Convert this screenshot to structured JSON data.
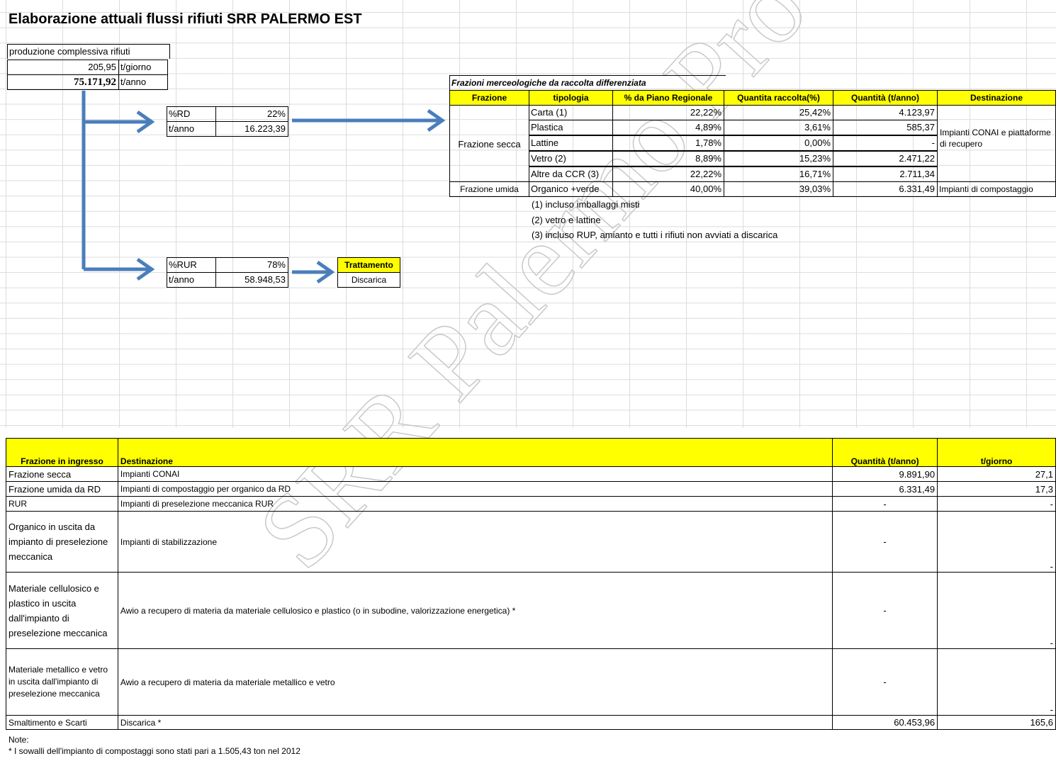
{
  "title": "Elaborazione attuali flussi rifiuti SRR PALERMO EST",
  "production": {
    "label": "produzione complessiva rifiuti",
    "daily_value": "205,95",
    "daily_unit": "t/giorno",
    "yearly_value": "75.171,92",
    "yearly_unit": "t/anno"
  },
  "rd_box": {
    "pct_label": "%RD",
    "pct_value": "22%",
    "t_label": "t/anno",
    "t_value": "16.223,39"
  },
  "rur_box": {
    "pct_label": "%RUR",
    "pct_value": "78%",
    "t_label": "t/anno",
    "t_value": "58.948,53"
  },
  "treatment": {
    "header": "Trattamento",
    "value": "Discarica"
  },
  "fractions_table": {
    "caption": "Frazioni merceologiche da raccolta differenziata",
    "headers": [
      "Frazione",
      "tipologia",
      "% da Piano Regionale",
      "Quantita raccolta(%)",
      "Quantità (t/anno)",
      "Destinazione"
    ],
    "group_secca": "Frazione secca",
    "group_umida": "Frazione umida",
    "rows": [
      {
        "tipologia": "Carta (1)",
        "pct_piano": "22,22%",
        "pct_raccolta": "25,42%",
        "quantita": "4.123,97"
      },
      {
        "tipologia": "Plastica",
        "pct_piano": "4,89%",
        "pct_raccolta": "3,61%",
        "quantita": "585,37"
      },
      {
        "tipologia": "Lattine",
        "pct_piano": "1,78%",
        "pct_raccolta": "0,00%",
        "quantita": "-"
      },
      {
        "tipologia": "Vetro (2)",
        "pct_piano": "8,89%",
        "pct_raccolta": "15,23%",
        "quantita": "2.471,22"
      },
      {
        "tipologia": "Altre da CCR (3)",
        "pct_piano": "22,22%",
        "pct_raccolta": "16,71%",
        "quantita": "2.711,34"
      },
      {
        "tipologia": "Organico +verde",
        "pct_piano": "40,00%",
        "pct_raccolta": "39,03%",
        "quantita": "6.331,49"
      }
    ],
    "dest_secca": "Impianti CONAI e piattaforme di recupero",
    "dest_umida": "Impianti di compostaggio",
    "footnotes": [
      "(1) incluso imballaggi misti",
      "(2) vetro e lattine",
      "(3) incluso RUP, amianto e tutti i rifiuti non avviati a discarica"
    ]
  },
  "bottom_table": {
    "headers": [
      "Frazione in ingresso",
      "Destinazione",
      "Quantità (t/anno)",
      "t/giorno"
    ],
    "rows": [
      {
        "frazione": "Frazione secca",
        "destinazione": "Impianti CONAI",
        "quantita": "9.891,90",
        "giorno": "27,1"
      },
      {
        "frazione": "Frazione umida da RD",
        "destinazione": "Impianti di compostaggio per organico da RD",
        "quantita": "6.331,49",
        "giorno": "17,3"
      },
      {
        "frazione": "RUR",
        "destinazione": "Impianti di preselezione meccanica RUR",
        "quantita": "-",
        "giorno": "-"
      },
      {
        "frazione": "Organico in uscita da impianto di preselezione meccanica",
        "destinazione": "Impianti di stabilizzazione",
        "quantita": "-",
        "giorno": "-"
      },
      {
        "frazione": "Materiale cellulosico e plastico in uscita dall'impianto di preselezione meccanica",
        "destinazione": "Awio a recupero di materia da materiale cellulosico e plastico (o in subodine, valorizzazione energetica) *",
        "quantita": "-",
        "giorno": "-"
      },
      {
        "frazione": "Materiale metallico e vetro in uscita dall'impianto di preselezione meccanica",
        "destinazione": "Awio a recupero di materia da materiale metallico e vetro",
        "quantita": "-",
        "giorno": "-"
      },
      {
        "frazione": "Smaltimento e Scarti",
        "destinazione": "Discarica *",
        "quantita": "60.453,96",
        "giorno": "165,6"
      }
    ]
  },
  "notes": {
    "label": "Note:",
    "text": "* I sowalli dell'impianto di compostaggi sono stati pari a 1.505,43 ton nel 2012"
  },
  "watermark": "SRR Palermo Provincia Est",
  "colors": {
    "header_fill": "#ffff00",
    "arrow": "#4a7ebb",
    "grid": "#dcdcdc"
  }
}
